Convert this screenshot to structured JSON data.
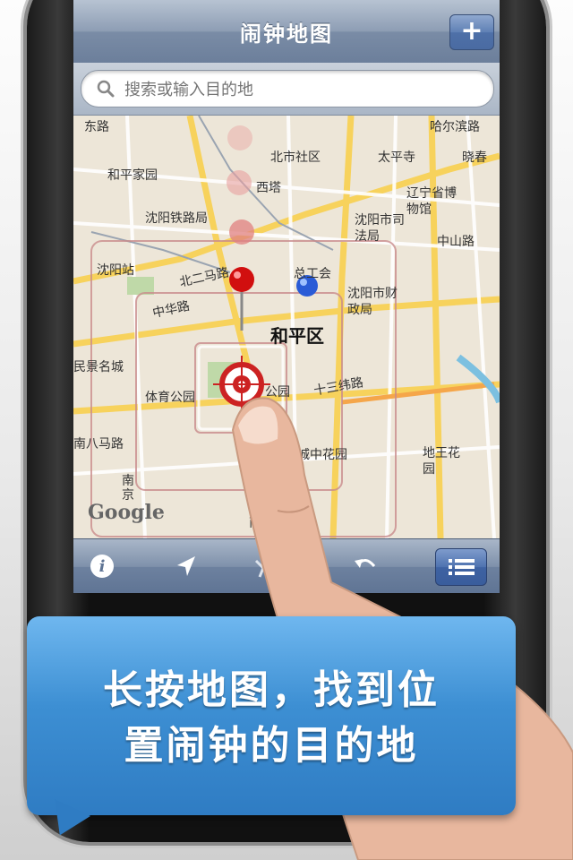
{
  "navbar": {
    "title": "闹钟地图",
    "add_label": "+"
  },
  "search": {
    "placeholder": "搜索或输入目的地"
  },
  "map": {
    "labels": {
      "dongxi_road": "东路",
      "beishi_community": "北市社区",
      "taiping_temple": "太平寺",
      "hal_road": "哈尔滨路",
      "xiaochun": "晓春",
      "heping_garden": "和平家园",
      "xita": "西塔",
      "liaoning_museum": "辽宁省博物馆",
      "shenyang_railway_bureau": "沈阳铁路局",
      "shenyang_court": "沈阳市司法局",
      "zhongshan_road": "中山路",
      "shenyang_station": "沈阳站",
      "north_2_road": "北二马路",
      "union_hall": "总工会",
      "shenyang_finance": "沈阳市财政局",
      "zhonghua_road": "中华路",
      "heping_district": "和平区",
      "minzu_city": "民景名城",
      "sports_park": "体育公园",
      "park": "公园",
      "shisan_road": "十三纬路",
      "south_8_road": "南八马路",
      "city_garden": "城中花园",
      "dishui_garden": "地王花园",
      "nan_road": "南京",
      "nan": "南"
    },
    "logo": "Google"
  },
  "toolbar": {
    "info_icon": "info-icon",
    "locate_icon": "location-arrow-icon",
    "pin_icon": "pin-icon",
    "undo_icon": "undo-icon",
    "list_icon": "list-icon"
  },
  "bubble": {
    "line1": "长按地图，找到位",
    "line2": "置闹钟的目的地"
  },
  "colors": {
    "accent": "#3d8fd3",
    "nav": "#7a8ca6"
  }
}
